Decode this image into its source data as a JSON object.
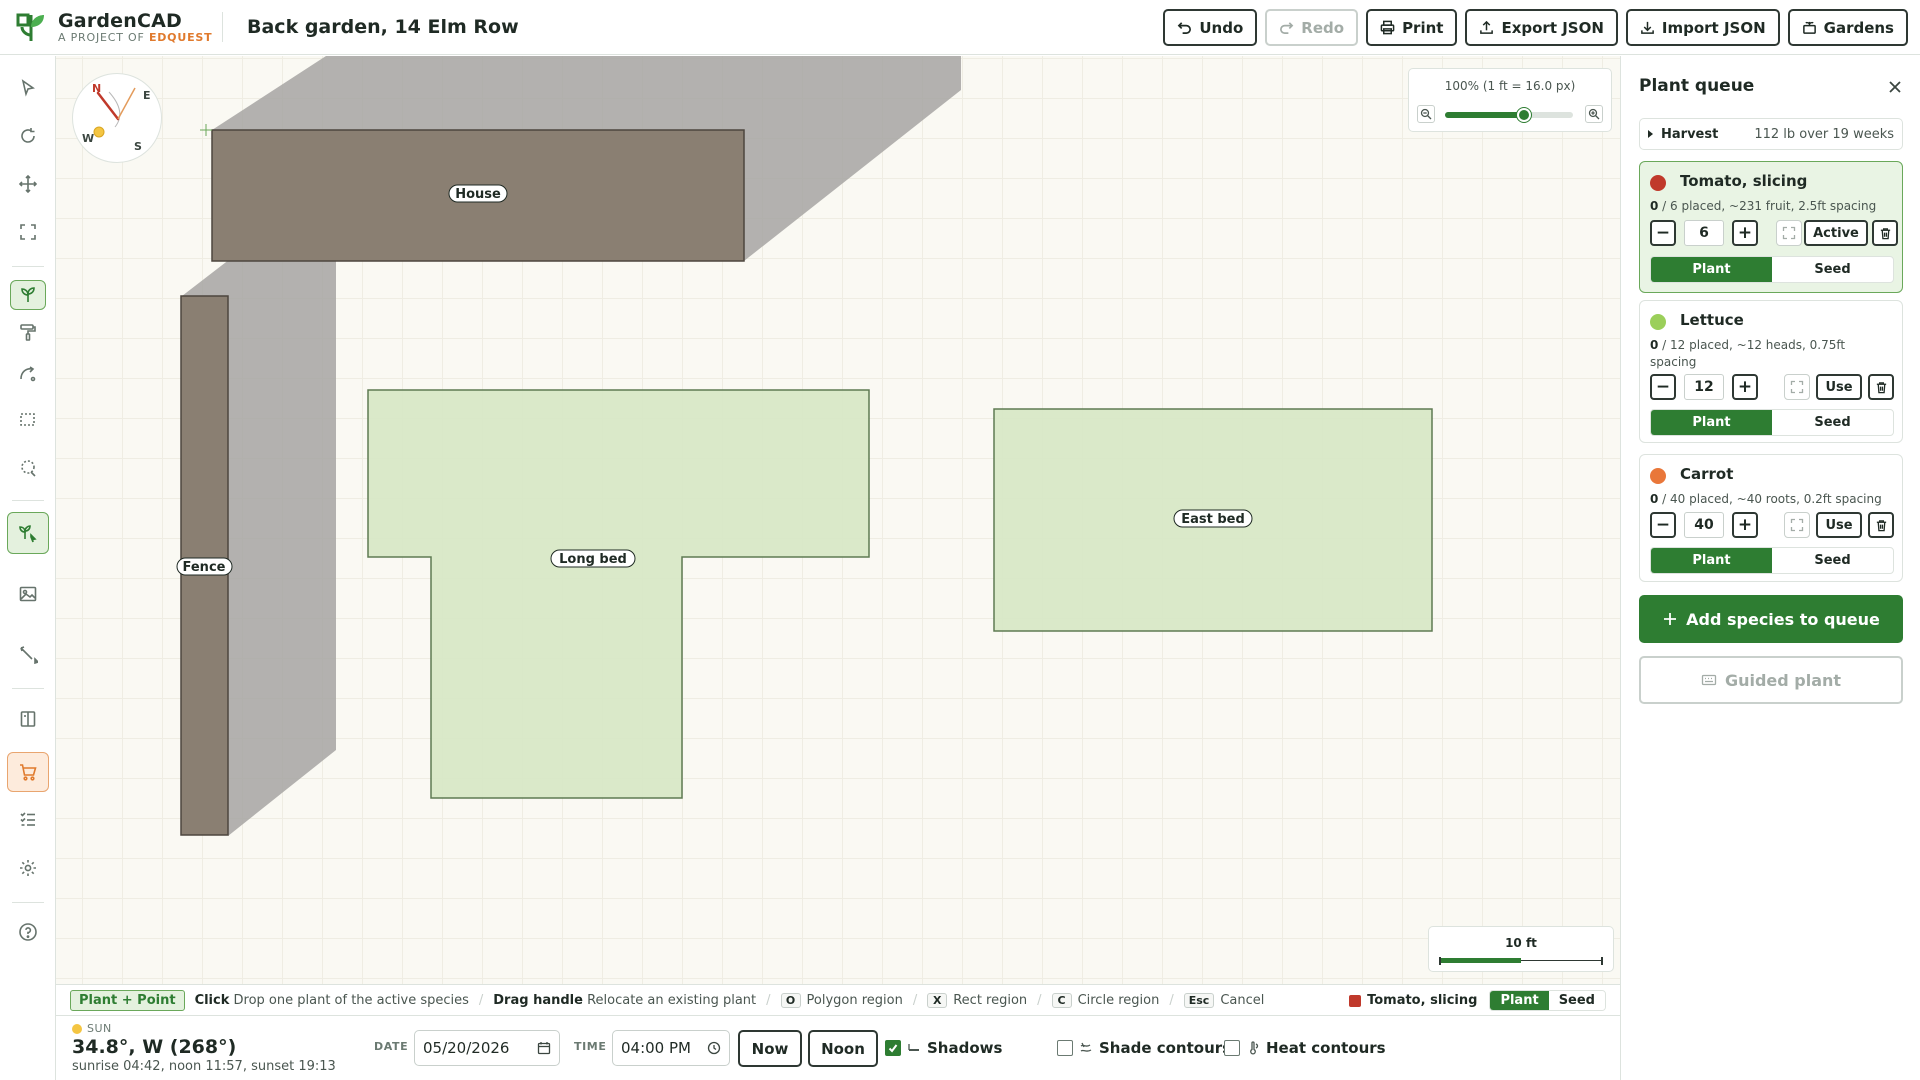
{
  "app": {
    "name": "GardenCAD",
    "tagline_prefix": "A PROJECT OF",
    "tagline_brand": "EDQUEST",
    "garden_title": "Back garden, 14 Elm Row"
  },
  "toolbar": {
    "undo": "Undo",
    "redo": "Redo",
    "print": "Print",
    "export": "Export JSON",
    "import": "Import JSON",
    "gardens": "Gardens"
  },
  "rail_icons": [
    "select-icon",
    "rotate-icon",
    "move-icon",
    "fit-icon",
    "sprout-icon",
    "paint-roller-icon",
    "curve-icon",
    "rect-select-icon",
    "lasso-icon",
    "plant-point-icon",
    "image-icon",
    "measure-icon",
    "book-icon",
    "cart-icon",
    "checklist-icon",
    "gear-icon",
    "help-icon"
  ],
  "canvas": {
    "shapes": {
      "house": "House",
      "fence": "Fence",
      "long_bed": "Long bed",
      "east_bed": "East bed"
    },
    "compass": {
      "n": "N",
      "e": "E",
      "s": "S",
      "w": "W"
    },
    "zoom": {
      "label": "100% (1 ft = 16.0 px)",
      "level": 0.62
    },
    "scale": {
      "label": "10 ft"
    }
  },
  "hint_bar": {
    "mode": "Plant + Point",
    "click_key": "Click",
    "click_desc": "Drop one plant of the active species",
    "drag_key": "Drag handle",
    "drag_desc": "Relocate an existing plant",
    "o_key": "O",
    "o_desc": "Polygon region",
    "x_key": "X",
    "x_desc": "Rect region",
    "c_key": "C",
    "c_desc": "Circle region",
    "esc_key": "Esc",
    "esc_desc": "Cancel",
    "active_species": "Tomato, slicing",
    "plant": "Plant",
    "seed": "Seed"
  },
  "bottom": {
    "sun_label": "SUN",
    "sun_position": "34.8°, W (268°)",
    "sun_times": "sunrise 04:42, noon 11:57, sunset 19:13",
    "date_label": "DATE",
    "date_value": "05/20/2026",
    "time_label": "TIME",
    "time_value": "04:00 PM",
    "now": "Now",
    "noon": "Noon",
    "shadows": "Shadows",
    "shade_contours": "Shade contours",
    "heat_contours": "Heat contours"
  },
  "panel": {
    "title": "Plant queue",
    "harvest_label": "Harvest",
    "harvest_value": "112 lb over 19 weeks",
    "items": [
      {
        "name": "Tomato, slicing",
        "color": "#c0392b",
        "placed": "0",
        "info": " / 6 placed, ~231 fruit, 2.5ft spacing",
        "qty": "6",
        "action": "Active",
        "plant": "Plant",
        "seed": "Seed"
      },
      {
        "name": "Lettuce",
        "color": "#9bcf5a",
        "placed": "0",
        "info": " / 12 placed, ~12 heads, 0.75ft spacing",
        "qty": "12",
        "action": "Use",
        "plant": "Plant",
        "seed": "Seed"
      },
      {
        "name": "Carrot",
        "color": "#e9773a",
        "placed": "0",
        "info": " / 40 placed, ~40 roots, 0.2ft spacing",
        "qty": "40",
        "action": "Use",
        "plant": "Plant",
        "seed": "Seed"
      }
    ],
    "add_species": "Add species to queue",
    "guided_plant": "Guided plant"
  }
}
